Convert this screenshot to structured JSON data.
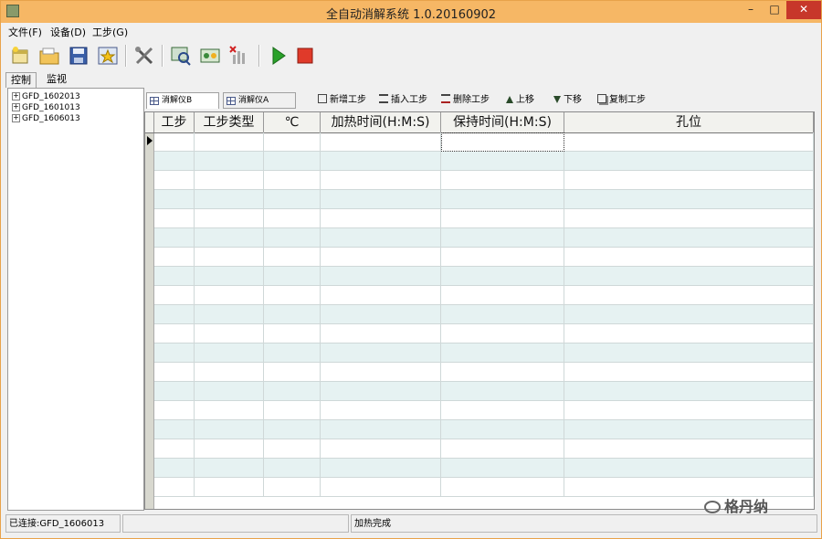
{
  "window": {
    "title": "全自动消解系统 1.0.20160902",
    "min_glyph": "–",
    "max_glyph": "□",
    "close_glyph": "✕"
  },
  "menu": {
    "items": [
      "文件(F)",
      "设备(D)",
      "工步(G)"
    ]
  },
  "toolbar": {
    "buttons": [
      "new-file-icon",
      "open-folder-icon",
      "save-icon",
      "favorite-star-icon",
      "tools-icon",
      "monitor-search-icon",
      "device-link-icon",
      "chart-delete-icon",
      "play-icon",
      "stop-icon"
    ],
    "colors": {
      "play": "#2aa12a",
      "stop": "#e03a2a"
    }
  },
  "left_tabs": [
    "控制",
    "监视"
  ],
  "tree": {
    "items": [
      "GFD_1602013",
      "GFD_1601013",
      "GFD_1606013"
    ]
  },
  "device_tabs": [
    "消解仪B",
    "消解仪A"
  ],
  "step_tools": [
    "新增工步",
    "插入工步",
    "删除工步",
    "上移",
    "下移",
    "复制工步"
  ],
  "grid": {
    "columns": [
      "工步",
      "工步类型",
      "℃",
      "加热时间(H:M:S)",
      "保持时间(H:M:S)",
      "孔位"
    ],
    "row_count": 19,
    "alt_color": "#e6f2f2"
  },
  "status": {
    "connection": "已连接:GFD_1606013",
    "middle": "",
    "message": "加热完成"
  },
  "watermark": "格丹纳"
}
